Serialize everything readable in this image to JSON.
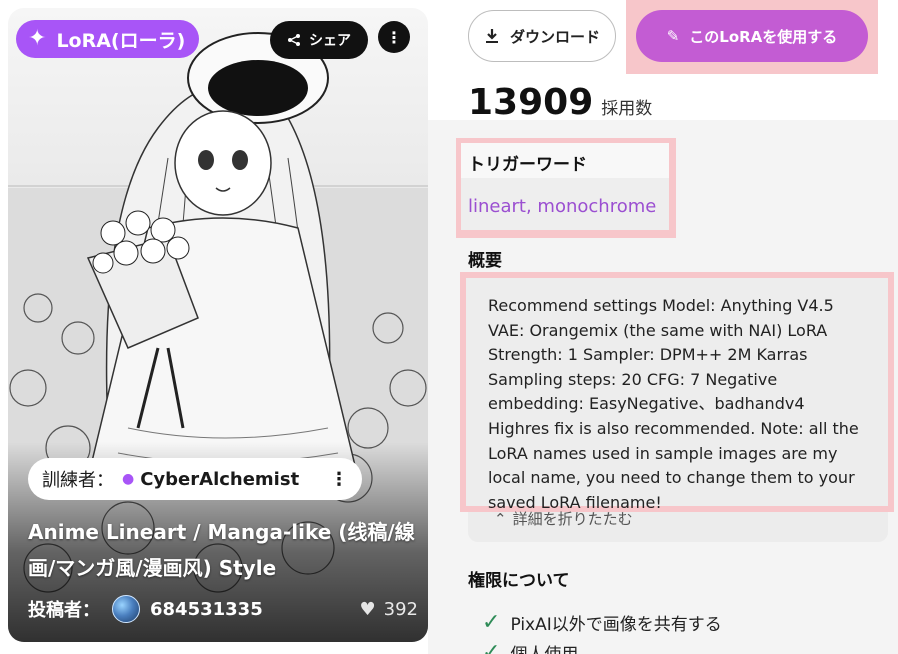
{
  "card": {
    "type_badge": "LoRA(ローラ)",
    "share_label": "シェア",
    "trainer_label": "訓練者：",
    "trainer_name": "CyberAlchemist",
    "title": "Anime Lineart / Manga-like (线稿/線画/マンガ風/漫画风) Style",
    "poster_label": "投稿者：",
    "poster_name": "684531335",
    "likes": "392"
  },
  "actions": {
    "download_label": "ダウンロード",
    "use_label": "このLoRAを使用する"
  },
  "stats": {
    "usage_count": "13909",
    "usage_label": "採用数"
  },
  "trigger": {
    "title": "トリガーワード",
    "words": "lineart, monochrome"
  },
  "summary": {
    "title": "概要",
    "text": "Recommend settings Model: Anything V4.5 VAE: Orangemix (the same with NAI) LoRA Strength: 1 Sampler: DPM++ 2M Karras Sampling steps: 20 CFG: 7 Negative embedding: EasyNegative、badhandv4 Highres fix is also recommended. Note: all the LoRA names used in sample images are my local name, you need to change them to your saved LoRA filename!",
    "collapse_label": "詳細を折りたたむ"
  },
  "permissions": {
    "title": "権限について",
    "items": [
      "PixAI以外で画像を共有する",
      "個人使用"
    ]
  },
  "icons": {
    "badge": "sparkle-icon",
    "share": "share-icon",
    "more": "more-vertical-icon",
    "download": "download-icon",
    "use": "brush-icon",
    "person": "person-icon",
    "heart": "heart-icon",
    "check": "check-icon",
    "collapse": "chevron-up-icon"
  },
  "colors": {
    "accent_purple": "#a855f7",
    "use_button": "#c35cd3",
    "trigger_text": "#9b4fd1",
    "highlight": "#f7c6ca"
  }
}
